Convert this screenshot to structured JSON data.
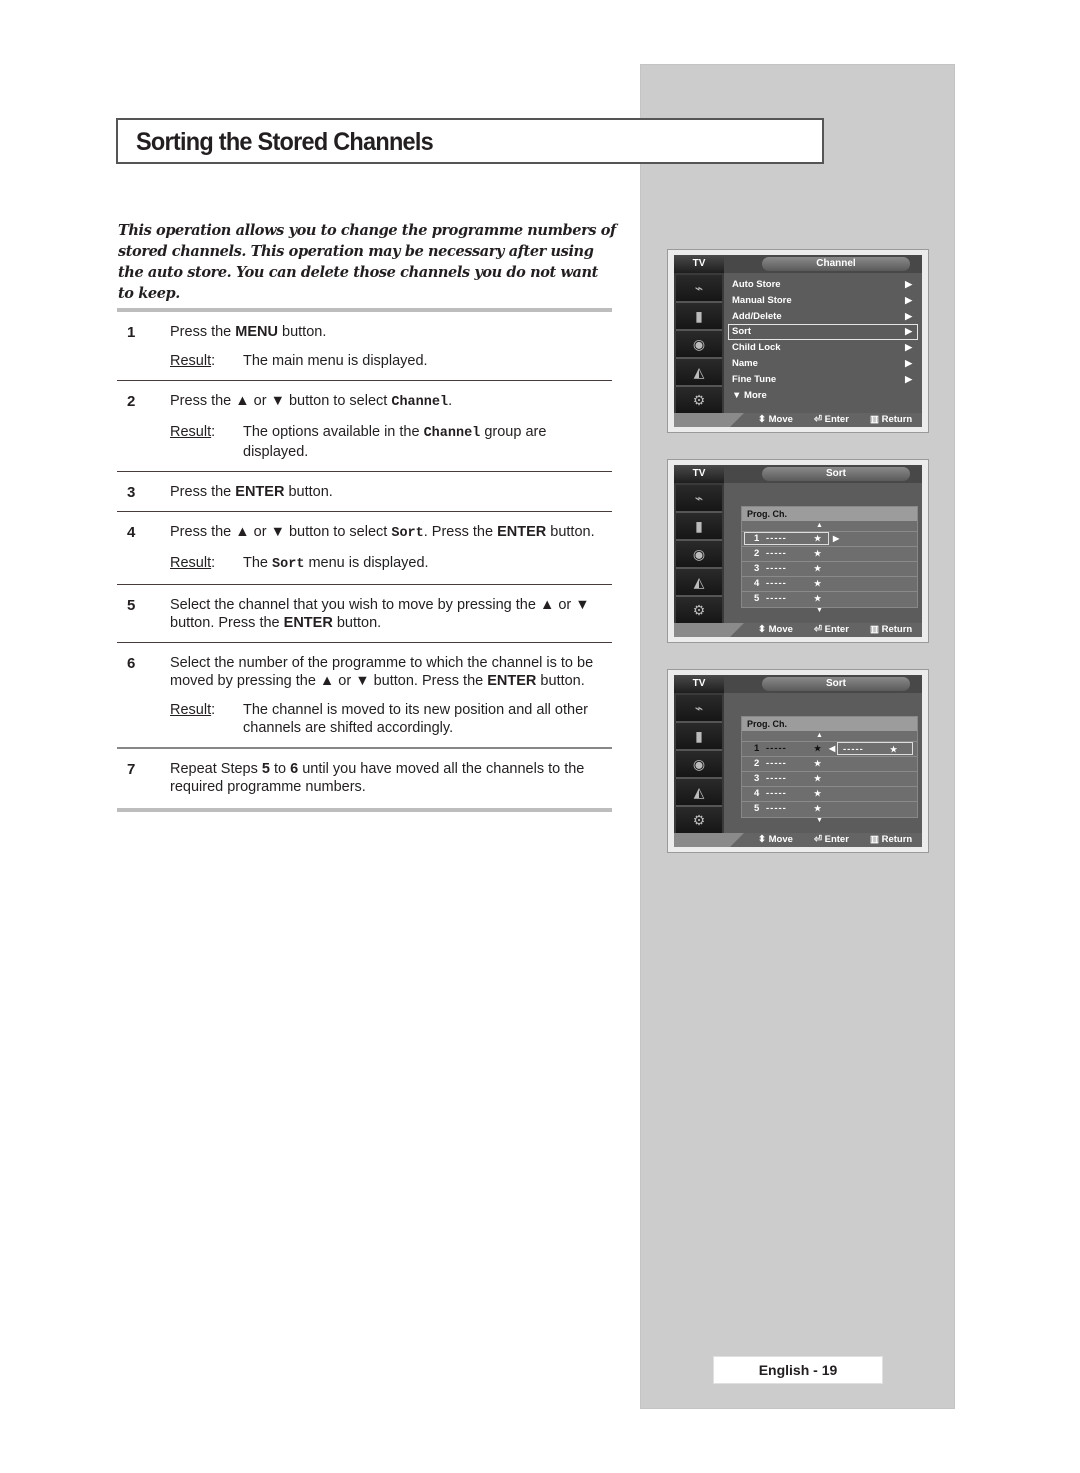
{
  "title": "Sorting the Stored Channels",
  "intro": "This operation allows you to change the programme numbers of stored channels. This operation may be necessary after using the auto store. You can delete those channels you do not want to keep.",
  "result_label": "Result",
  "steps": [
    {
      "num": "1",
      "text_pre": "Press the ",
      "bold": "MENU",
      "text_post": " button.",
      "result": "The main menu is displayed."
    },
    {
      "num": "2",
      "text_pre": "Press the ▲ or ▼ button to select ",
      "mono": "Channel",
      "text_post": ".",
      "result_pre": "The options available in the ",
      "result_mono": "Channel",
      "result_post": " group are displayed."
    },
    {
      "num": "3",
      "text_pre": "Press the ",
      "bold": "ENTER",
      "text_post": " button."
    },
    {
      "num": "4",
      "text_pre": "Press the ▲ or ▼ button to select ",
      "mono": "Sort",
      "text_mid": ". Press the ",
      "bold": "ENTER",
      "text_post": " button.",
      "result_pre": "The ",
      "result_mono": "Sort",
      "result_post": " menu is displayed."
    },
    {
      "num": "5",
      "text_pre": "Select the channel that you wish to move by pressing the ▲ or ▼ button. Press the ",
      "bold": "ENTER",
      "text_post": " button."
    },
    {
      "num": "6",
      "text_pre": "Select the number of the programme to which the channel is to be moved by pressing the ▲ or ▼ button. Press the ",
      "bold": "ENTER",
      "text_post": " button.",
      "result": "The channel is moved to its new position and all other channels are shifted accordingly."
    },
    {
      "num": "7",
      "text_pre": "Repeat Steps ",
      "bold": "5",
      "text_mid": " to ",
      "bold2": "6",
      "text_post": " until you have moved all the channels to the required programme numbers."
    }
  ],
  "osd": {
    "tv_label": "TV",
    "footer": {
      "move": "Move",
      "enter": "Enter",
      "return": "Return"
    },
    "icons": [
      "input-icon",
      "picture-icon",
      "sound-icon",
      "channel-icon",
      "setup-icon"
    ],
    "screen1": {
      "header": "Channel",
      "items": [
        {
          "label": "Auto Store",
          "arrow": "▶"
        },
        {
          "label": "Manual Store",
          "arrow": "▶"
        },
        {
          "label": "Add/Delete",
          "arrow": "▶"
        },
        {
          "label": "Sort",
          "arrow": "▶",
          "selected": true
        },
        {
          "label": "Child Lock",
          "arrow": "▶"
        },
        {
          "label": "Name",
          "arrow": "▶"
        },
        {
          "label": "Fine Tune",
          "arrow": "▶"
        },
        {
          "label": "▼ More",
          "arrow": ""
        }
      ]
    },
    "screen2": {
      "header": "Sort",
      "col_header": "Prog.  Ch.",
      "rows": [
        {
          "prog": "1",
          "ch": "-----",
          "star": "★"
        },
        {
          "prog": "2",
          "ch": "-----",
          "star": "★"
        },
        {
          "prog": "3",
          "ch": "-----",
          "star": "★"
        },
        {
          "prog": "4",
          "ch": "-----",
          "star": "★"
        },
        {
          "prog": "5",
          "ch": "-----",
          "star": "★"
        }
      ]
    },
    "screen3": {
      "header": "Sort",
      "col_header": "Prog.  Ch.",
      "moving": {
        "ch": "-----",
        "star": "★"
      },
      "rows": [
        {
          "prog": "1",
          "ch": "-----",
          "star": "★"
        },
        {
          "prog": "2",
          "ch": "-----",
          "star": "★"
        },
        {
          "prog": "3",
          "ch": "-----",
          "star": "★"
        },
        {
          "prog": "4",
          "ch": "-----",
          "star": "★"
        },
        {
          "prog": "5",
          "ch": "-----",
          "star": "★"
        }
      ]
    }
  },
  "page_label": "English - 19"
}
